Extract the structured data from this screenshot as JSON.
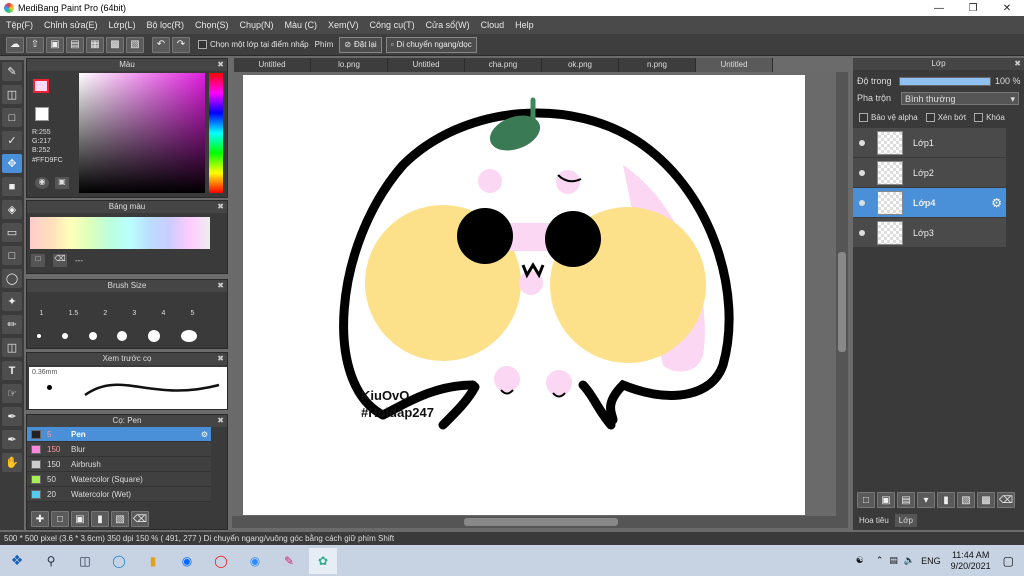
{
  "window": {
    "title": "MediBang Paint Pro (64bit)"
  },
  "menu": [
    "Tệp(F)",
    "Chỉnh sửa(E)",
    "Lớp(L)",
    "Bộ lọc(R)",
    "Chọn(S)",
    "Chụp(N)",
    "Màu (C)",
    "Xem(V)",
    "Công cụ(T)",
    "Cửa sổ(W)",
    "Cloud",
    "Help"
  ],
  "toolbar": {
    "snap_label": "Chọn một lớp tại điểm nhấp",
    "brush_label": "Phím",
    "reset_label": "Đặt lại",
    "flip_label": "Di chuyển ngang/dọc"
  },
  "color_panel": {
    "title": "Màu",
    "r": "R:255",
    "g": "G:217",
    "b": "B:252",
    "hex": "#FFD9FC"
  },
  "palette_panel": {
    "title": "Bảng màu",
    "note": "---"
  },
  "brush_size_panel": {
    "title": "Brush Size",
    "sizes": [
      "1",
      "1.5",
      "2",
      "3",
      "4",
      "5"
    ]
  },
  "preview_panel": {
    "title": "Xem trước cọ",
    "size": "0.36mm"
  },
  "brush_panel": {
    "title": "Cọ: Pen",
    "items": [
      {
        "size": "5",
        "name": "Pen",
        "color": "#222222"
      },
      {
        "size": "150",
        "name": "Blur",
        "color": "#ff88dd"
      },
      {
        "size": "150",
        "name": "Airbrush",
        "color": "#cccccc"
      },
      {
        "size": "50",
        "name": "Watercolor (Square)",
        "color": "#aaee55"
      },
      {
        "size": "20",
        "name": "Watercolor (Wet)",
        "color": "#55ccee"
      }
    ]
  },
  "tabs": [
    "Untitled",
    "lo.png",
    "Untitled",
    "cha.png",
    "ok.png",
    "n.png",
    "Untitled"
  ],
  "canvas": {
    "watermark_line1": "KiuOvO",
    "watermark_line2": "#Hoidap247"
  },
  "layer_panel": {
    "title": "Lớp",
    "opacity_label": "Độ trong",
    "opacity_value": "100 %",
    "opacity_fraction": 1.0,
    "blend_label": "Pha trộn",
    "blend_value": "Bình thường",
    "alpha_label": "Bảo vệ alpha",
    "clip_label": "Xén bớt",
    "lock_label": "Khóa",
    "layers": [
      "Lớp1",
      "Lớp2",
      "Lớp4",
      "Lớp3"
    ],
    "tab_nav": "Hoa tiêu",
    "tab_layer": "Lớp"
  },
  "status": "500 * 500 pixel   (3.6 * 3.6cm)   350 dpi   150 %   ( 491, 277 )   Di chuyển ngang/vuông góc bằng cách giữ phím Shift",
  "taskbar": {
    "lang": "ENG",
    "time": "11:44 AM",
    "date": "9/20/2021"
  }
}
